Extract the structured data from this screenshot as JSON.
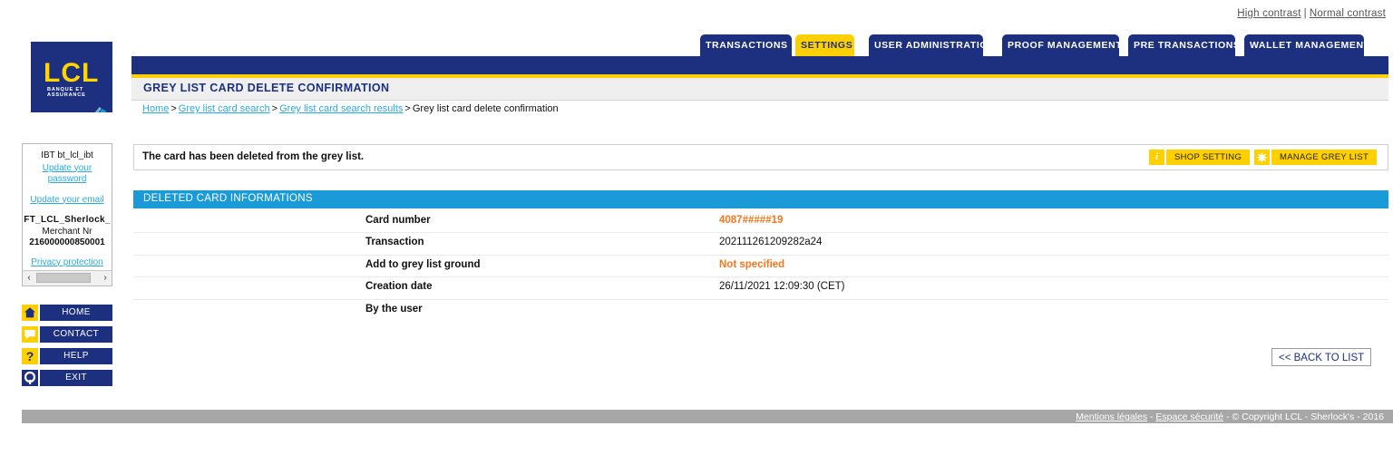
{
  "contrast": {
    "high": "High contrast",
    "separator": "|",
    "normal": "Normal contrast"
  },
  "logo": {
    "text": "LCL",
    "tagline": "BANQUE ET ASSURANCE"
  },
  "tabs": [
    {
      "label": "TRANSACTIONS",
      "active": false
    },
    {
      "label": "SETTINGS",
      "active": true
    },
    {
      "label": "USER ADMINISTRATION",
      "active": false
    },
    {
      "label": "PROOF MANAGEMENT",
      "active": false
    },
    {
      "label": "PRE TRANSACTIONS",
      "active": false
    },
    {
      "label": "WALLET MANAGEMENT",
      "active": false
    }
  ],
  "page": {
    "title": "GREY LIST CARD DELETE CONFIRMATION"
  },
  "breadcrumb": {
    "items": [
      {
        "label": "Home",
        "link": true
      },
      {
        "label": "Grey list card search",
        "link": true
      },
      {
        "label": "Grey list card search results",
        "link": true
      },
      {
        "label": "Grey list card delete confirmation",
        "link": false
      }
    ],
    "separator": ">"
  },
  "sidebar": {
    "user": "IBT bt_lcl_ibt",
    "update_password": "Update your password",
    "update_email": "Update your email",
    "merchant_name": "FT_LCL_Sherlock_",
    "merchant_label": "Merchant Nr",
    "merchant_number": "216000000850001",
    "privacy": "Privacy protection",
    "scroll_left": "‹",
    "scroll_right": "›"
  },
  "nav_buttons": [
    {
      "label": "HOME",
      "icon": "home-icon"
    },
    {
      "label": "CONTACT",
      "icon": "contact-icon"
    },
    {
      "label": "HELP",
      "icon": "help-icon"
    },
    {
      "label": "EXIT",
      "icon": "exit-icon"
    }
  ],
  "message": {
    "text": "The card has been deleted from the grey list."
  },
  "actions": [
    {
      "label": "SHOP SETTING",
      "icon": "info-icon"
    },
    {
      "label": "MANAGE GREY LIST",
      "icon": "star-icon"
    }
  ],
  "section": {
    "title": "DELETED CARD INFORMATIONS",
    "rows": [
      {
        "label": "Card number",
        "value": "4087#####19",
        "emphasis": "orange"
      },
      {
        "label": "Transaction",
        "value": "202111261209282a24",
        "emphasis": "none"
      },
      {
        "label": "Add to grey list ground",
        "value": "Not specified",
        "emphasis": "orange"
      },
      {
        "label": "Creation date",
        "value": "26/11/2021 12:09:30 (CET)",
        "emphasis": "none"
      },
      {
        "label": "By the user",
        "value": "",
        "emphasis": "none"
      }
    ]
  },
  "back_button": {
    "label": "<< BACK TO LIST"
  },
  "footer": {
    "legal": "Mentions légales",
    "security": "Espace sécurité",
    "copyright": "© Copyright LCL - Sherlock's - 2016",
    "separator": "-"
  },
  "colors": {
    "navy": "#1d3080",
    "yellow": "#ffd000",
    "blue": "#1b9ad8",
    "orange": "#f5761a",
    "link": "#29abe2",
    "grey": "#a7a7a7"
  }
}
